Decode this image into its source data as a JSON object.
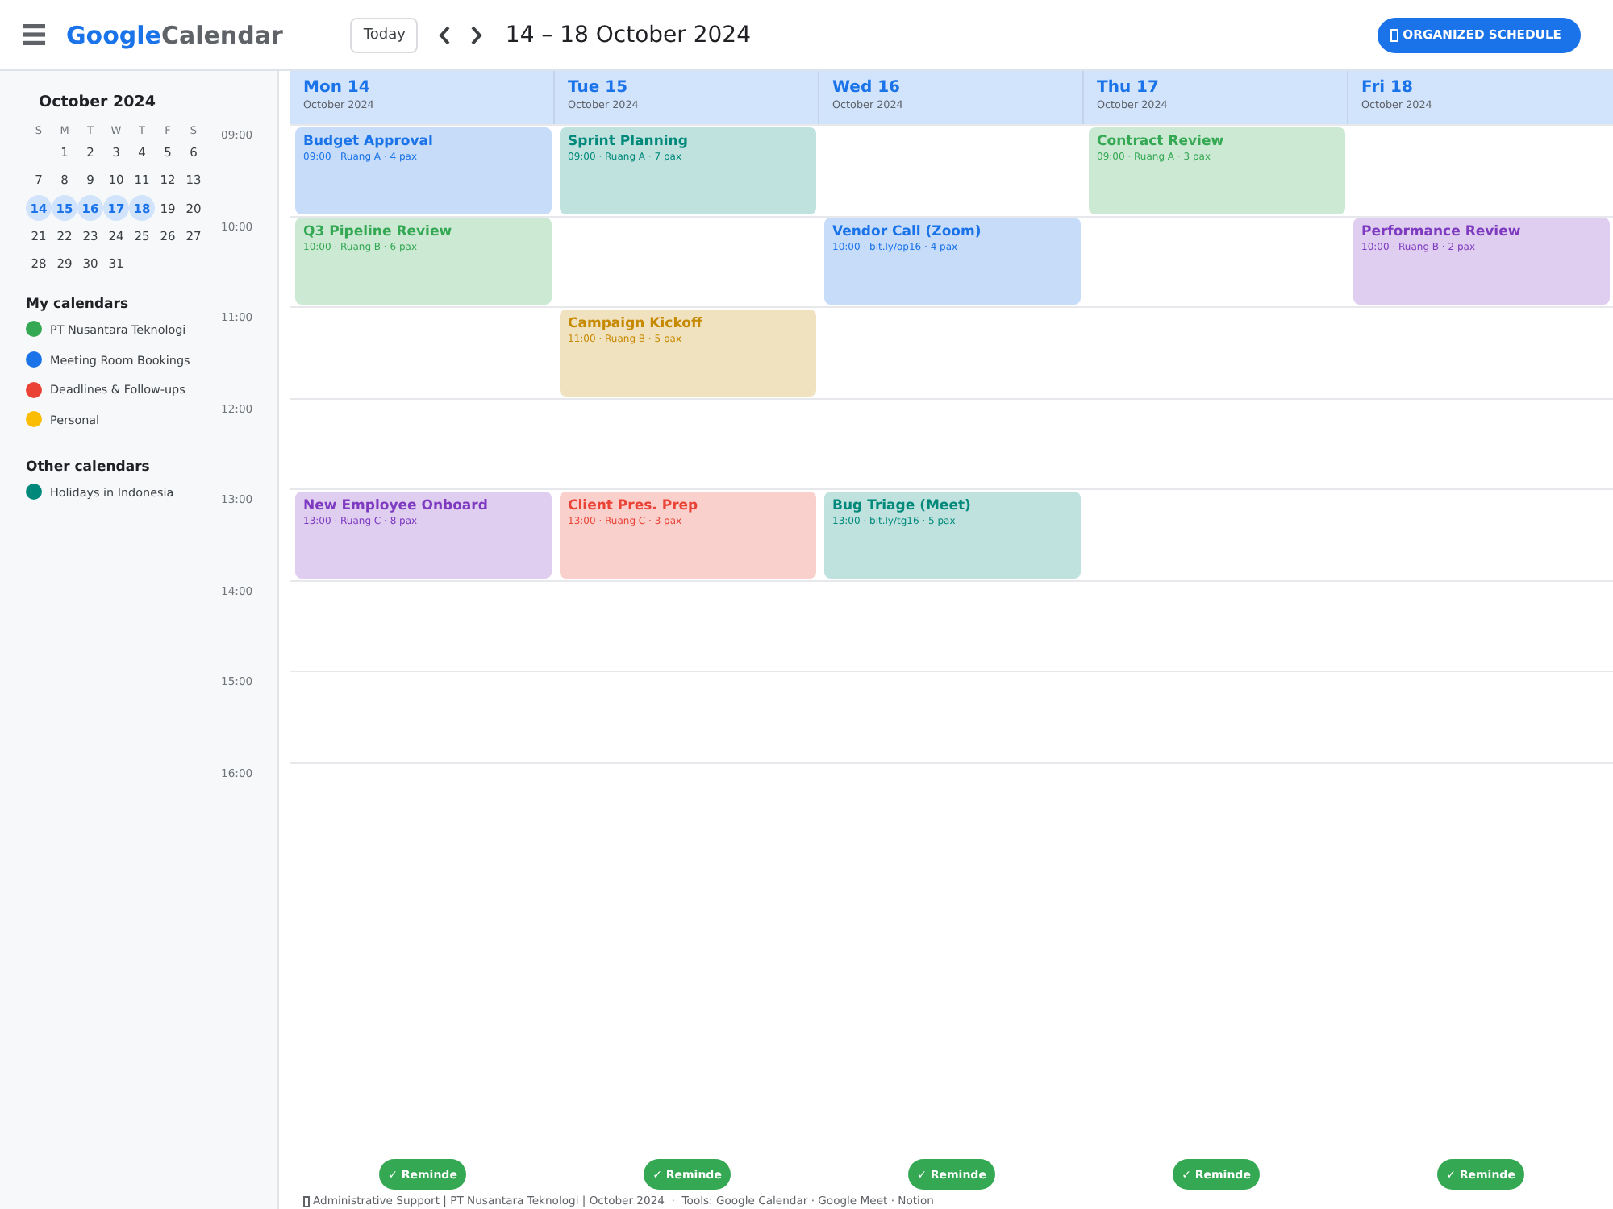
{
  "topbar": {
    "brand": "Google",
    "product": "Calendar",
    "today_button": "Today",
    "range_title": "14 – 18 October 2024",
    "action_button": "ORGANIZED SCHEDULE"
  },
  "mini_calendar": {
    "title": "October 2024",
    "weekdays": [
      "S",
      "M",
      "T",
      "W",
      "T",
      "F",
      "S"
    ],
    "weeks": [
      [
        {
          "day": "1",
          "selected": false
        },
        {
          "day": "2",
          "selected": false
        },
        {
          "day": "3",
          "selected": false
        },
        {
          "day": "4",
          "selected": false
        },
        {
          "day": "5",
          "selected": false
        },
        {
          "day": "6",
          "selected": false
        }
      ],
      [
        {
          "day": "7",
          "selected": false
        },
        {
          "day": "8",
          "selected": false
        },
        {
          "day": "9",
          "selected": false
        },
        {
          "day": "10",
          "selected": false
        },
        {
          "day": "11",
          "selected": false
        },
        {
          "day": "12",
          "selected": false
        },
        {
          "day": "13",
          "selected": false
        }
      ],
      [
        {
          "day": "14",
          "selected": true
        },
        {
          "day": "15",
          "selected": true
        },
        {
          "day": "16",
          "selected": true
        },
        {
          "day": "17",
          "selected": true
        },
        {
          "day": "18",
          "selected": true
        },
        {
          "day": "19",
          "selected": false
        },
        {
          "day": "20",
          "selected": false
        }
      ],
      [
        {
          "day": "21",
          "selected": false
        },
        {
          "day": "22",
          "selected": false
        },
        {
          "day": "23",
          "selected": false
        },
        {
          "day": "24",
          "selected": false
        },
        {
          "day": "25",
          "selected": false
        },
        {
          "day": "26",
          "selected": false
        },
        {
          "day": "27",
          "selected": false
        }
      ],
      [
        {
          "day": "28",
          "selected": false
        },
        {
          "day": "29",
          "selected": false
        },
        {
          "day": "30",
          "selected": false
        },
        {
          "day": "31",
          "selected": false
        }
      ]
    ]
  },
  "calendar_groups": [
    {
      "title": "My calendars",
      "items": [
        {
          "label": "PT Nusantara Teknologi",
          "color": "#34a853"
        },
        {
          "label": "Meeting Room Bookings",
          "color": "#1a73e8"
        },
        {
          "label": "Deadlines & Follow-ups",
          "color": "#ea4335"
        },
        {
          "label": "Personal",
          "color": "#fbbc04"
        }
      ]
    },
    {
      "title": "Other calendars",
      "items": [
        {
          "label": "Holidays in Indonesia",
          "color": "#00897b"
        }
      ]
    }
  ],
  "days": [
    {
      "name": "Mon 14",
      "month": "October 2024",
      "reminder": "✓ Reminde"
    },
    {
      "name": "Tue 15",
      "month": "October 2024",
      "reminder": "✓ Reminde"
    },
    {
      "name": "Wed 16",
      "month": "October 2024",
      "reminder": "✓ Reminde"
    },
    {
      "name": "Thu 17",
      "month": "October 2024",
      "reminder": "✓ Reminde"
    },
    {
      "name": "Fri 18",
      "month": "October 2024",
      "reminder": "✓ Reminde"
    }
  ],
  "rows": [
    {
      "time": "09:00",
      "cells": [
        {
          "kind": "event",
          "title": "Budget Approval",
          "detail": "09:00 · Ruang A · 4 pax",
          "color": "#1a73e8"
        },
        {
          "kind": "event",
          "title": "Sprint Planning",
          "detail": "09:00 · Ruang A · 7 pax",
          "color": "#00897b"
        },
        {
          "kind": "empty"
        },
        {
          "kind": "event",
          "title": "Contract Review",
          "detail": "09:00 · Ruang A · 3 pax",
          "color": "#34a853"
        },
        {
          "kind": "empty"
        }
      ]
    },
    {
      "time": "10:00",
      "cells": [
        {
          "kind": "event",
          "title": "Q3 Pipeline Review",
          "detail": "10:00 · Ruang B · 6 pax",
          "color": "#34a853"
        },
        {
          "kind": "empty"
        },
        {
          "kind": "event",
          "title": "Vendor Call (Zoom)",
          "detail": "10:00 · bit.ly/op16 · 4 pax",
          "color": "#1a73e8"
        },
        {
          "kind": "empty"
        },
        {
          "kind": "event",
          "title": "Performance Review",
          "detail": "10:00 · Ruang B · 2 pax",
          "color": "#7e3ac0"
        }
      ]
    },
    {
      "time": "11:00",
      "cells": [
        {
          "kind": "empty"
        },
        {
          "kind": "event",
          "title": "Campaign Kickoff",
          "detail": "11:00 · Ruang B · 5 pax",
          "color": "#c68a00"
        },
        {
          "kind": "empty"
        },
        {
          "kind": "empty"
        },
        {
          "kind": "empty"
        }
      ]
    },
    {
      "time": "12:00",
      "cells": [
        {
          "kind": "empty"
        },
        {
          "kind": "empty"
        },
        {
          "kind": "empty"
        },
        {
          "kind": "empty"
        },
        {
          "kind": "empty"
        }
      ]
    },
    {
      "time": "13:00",
      "cells": [
        {
          "kind": "event",
          "title": "New Employee Onboard",
          "detail": "13:00 · Ruang C · 8 pax",
          "color": "#7e3ac0"
        },
        {
          "kind": "event",
          "title": "Client Pres. Prep",
          "detail": "13:00 · Ruang C · 3 pax",
          "color": "#ea4335"
        },
        {
          "kind": "event",
          "title": "Bug Triage (Meet)",
          "detail": "13:00 · bit.ly/tg16 · 5 pax",
          "color": "#00897b"
        },
        {
          "kind": "empty"
        },
        {
          "kind": "empty"
        }
      ]
    },
    {
      "time": "14:00",
      "cells": [
        {
          "kind": "empty"
        },
        {
          "kind": "empty"
        },
        {
          "kind": "empty"
        },
        {
          "kind": "empty"
        },
        {
          "kind": "empty"
        }
      ]
    },
    {
      "time": "15:00",
      "cells": [
        {
          "kind": "empty"
        },
        {
          "kind": "empty"
        },
        {
          "kind": "empty"
        },
        {
          "kind": "empty"
        },
        {
          "kind": "empty"
        }
      ]
    },
    {
      "time": "16:00",
      "cells": [
        {
          "kind": "empty"
        },
        {
          "kind": "empty"
        },
        {
          "kind": "empty"
        },
        {
          "kind": "empty"
        },
        {
          "kind": "empty"
        }
      ]
    }
  ],
  "footer": "Administrative Support | PT Nusantara Teknologi | October 2024  ·  Tools: Google Calendar · Google Meet · Notion"
}
